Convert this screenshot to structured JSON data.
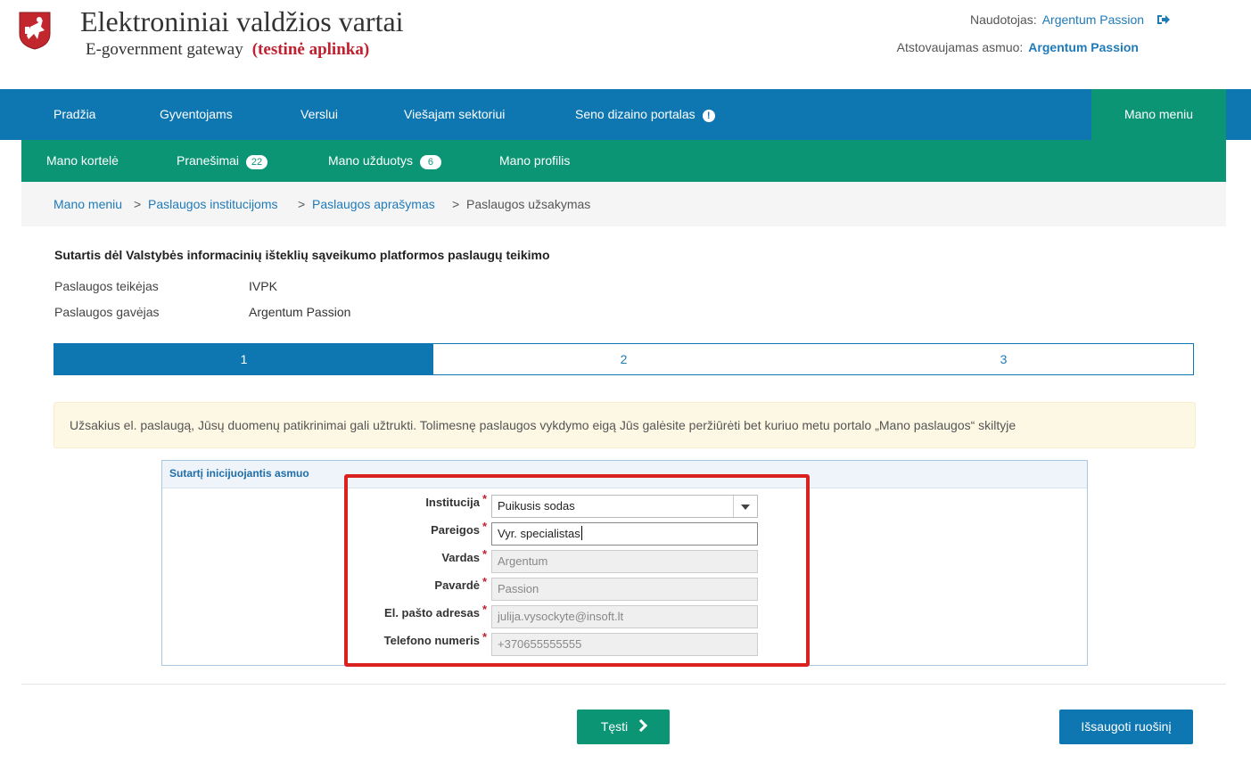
{
  "header": {
    "title": "Elektroniniai valdžios vartai",
    "subtitle": "E-government gateway",
    "env_label": "(testinė aplinka)",
    "user_label": "Naudotojas:",
    "user_name": "Argentum Passion",
    "represented_label": "Atstovaujamas asmuo:",
    "represented_name": "Argentum Passion"
  },
  "topnav": {
    "items": [
      "Pradžia",
      "Gyventojams",
      "Verslui",
      "Viešajam sektoriui",
      "Seno dizaino portalas"
    ],
    "mano_meniu": "Mano meniu"
  },
  "subnav": {
    "items": [
      {
        "label": "Mano kortelė",
        "badge": ""
      },
      {
        "label": "Pranešimai",
        "badge": "22"
      },
      {
        "label": "Mano užduotys",
        "badge": "6"
      },
      {
        "label": "Mano profilis",
        "badge": ""
      }
    ]
  },
  "breadcrumb": {
    "items": [
      "Mano meniu",
      "Paslaugos institucijoms",
      "Paslaugos aprašymas"
    ],
    "current": "Paslaugos užsakymas",
    "separator": ">"
  },
  "contract": {
    "title": "Sutartis dėl Valstybės informacinių išteklių sąveikumo platformos paslaugų teikimo",
    "provider_label": "Paslaugos teikėjas",
    "provider_value": "IVPK",
    "receiver_label": "Paslaugos gavėjas",
    "receiver_value": "Argentum Passion"
  },
  "steps": [
    "1",
    "2",
    "3"
  ],
  "alert": "Užsakius el. paslaugą, Jūsų duomenų patikrinimai gali užtrukti. Tolimesnę paslaugos vykdymo eigą Jūs galėsite peržiūrėti bet kuriuo metu portalo „Mano paslaugos“ skiltyje",
  "panel": {
    "title": "Sutartį inicijuojantis asmuo",
    "fields": {
      "institucija": {
        "label": "Institucija",
        "value": "Puikusis sodas"
      },
      "pareigos": {
        "label": "Pareigos",
        "value": "Vyr. specialistas"
      },
      "vardas": {
        "label": "Vardas",
        "value": "Argentum"
      },
      "pavarde": {
        "label": "Pavardė",
        "value": "Passion"
      },
      "email": {
        "label": "El. pašto adresas",
        "value": "julija.vysockyte@insoft.lt"
      },
      "phone": {
        "label": "Telefono numeris",
        "value": "+370655555555"
      }
    },
    "required_mark": "*"
  },
  "buttons": {
    "next": "Tęsti",
    "save_draft": "Išsaugoti ruošinį"
  },
  "colors": {
    "primary_blue": "#0e76b1",
    "green": "#0b9575",
    "highlight_red": "#d9211f",
    "link_blue": "#1f7ab8"
  }
}
